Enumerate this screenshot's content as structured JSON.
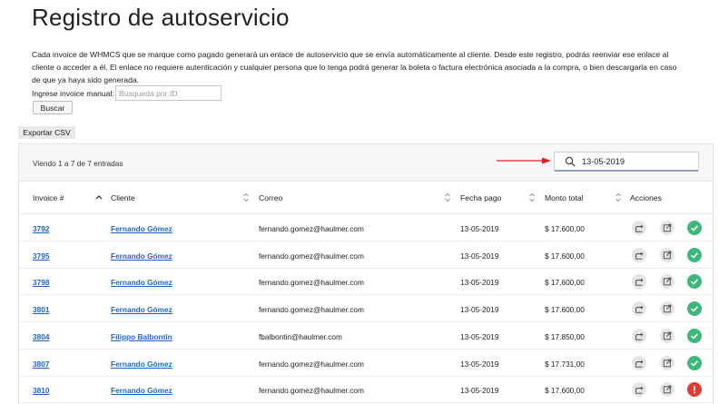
{
  "page": {
    "title": "Registro de autoservicio",
    "description": "Cada invoice de WHMCS que se marque como pagado generará un enlace de autoservicio que se envía automáticamente al cliente. Desde este registro, podrás reenviar ese enlace al cliente o acceder a él. El enlace no requiere autenticación y cualquier persona que lo tenga podrá generar la boleta o factura electrónica asociada a la compra, o bien descargarla en caso de que ya haya sido generada."
  },
  "manual_search": {
    "label": "Ingrese invoice manual:",
    "placeholder": "Busqueda por ID",
    "button_label": "Buscar"
  },
  "export": {
    "label": "Exportar CSV"
  },
  "table": {
    "entries_info": "Viendo 1 a 7 de 7 entradas",
    "filter_value": "13-05-2019",
    "columns": {
      "invoice": "Invoice #",
      "client": "Cliente",
      "email": "Correo",
      "date": "Fecha pago",
      "amount": "Monto total",
      "actions": "Acciones"
    },
    "rows": [
      {
        "invoice": "3792",
        "client": "Fernando Gómez",
        "email": "fernando.gomez@haulmer.com",
        "date": "13-05-2019",
        "amount": "$ 17.600,00",
        "status": "ok"
      },
      {
        "invoice": "3795",
        "client": "Fernando Gómez",
        "email": "fernando.gomez@haulmer.com",
        "date": "13-05-2019",
        "amount": "$ 17.600,00",
        "status": "ok"
      },
      {
        "invoice": "3798",
        "client": "Fernando Gómez",
        "email": "fernando.gomez@haulmer.com",
        "date": "13-05-2019",
        "amount": "$ 17.600,00",
        "status": "ok"
      },
      {
        "invoice": "3801",
        "client": "Fernando Gómez",
        "email": "fernando.gomez@haulmer.com",
        "date": "13-05-2019",
        "amount": "$ 17.600,00",
        "status": "ok"
      },
      {
        "invoice": "3804",
        "client": "Filippo Balbontin",
        "email": "fbalbontin@haulmer.com",
        "date": "13-05-2019",
        "amount": "$ 17.850,00",
        "status": "ok"
      },
      {
        "invoice": "3807",
        "client": "Fernando Gómez",
        "email": "fernando.gomez@haulmer.com",
        "date": "13-05-2019",
        "amount": "$ 17.731,00",
        "status": "ok"
      },
      {
        "invoice": "3810",
        "client": "Fernando Gómez",
        "email": "fernando.gomez@haulmer.com",
        "date": "13-05-2019",
        "amount": "$ 17.600,00",
        "status": "error"
      }
    ]
  },
  "icons": {
    "send": "forward-icon",
    "open": "external-link-icon",
    "status_ok": "check-circle-icon",
    "status_error": "error-circle-icon"
  },
  "colors": {
    "link": "#1f66c9",
    "status_ok": "#3cb878",
    "status_error": "#e53935",
    "annotation_arrow": "#e02020"
  }
}
